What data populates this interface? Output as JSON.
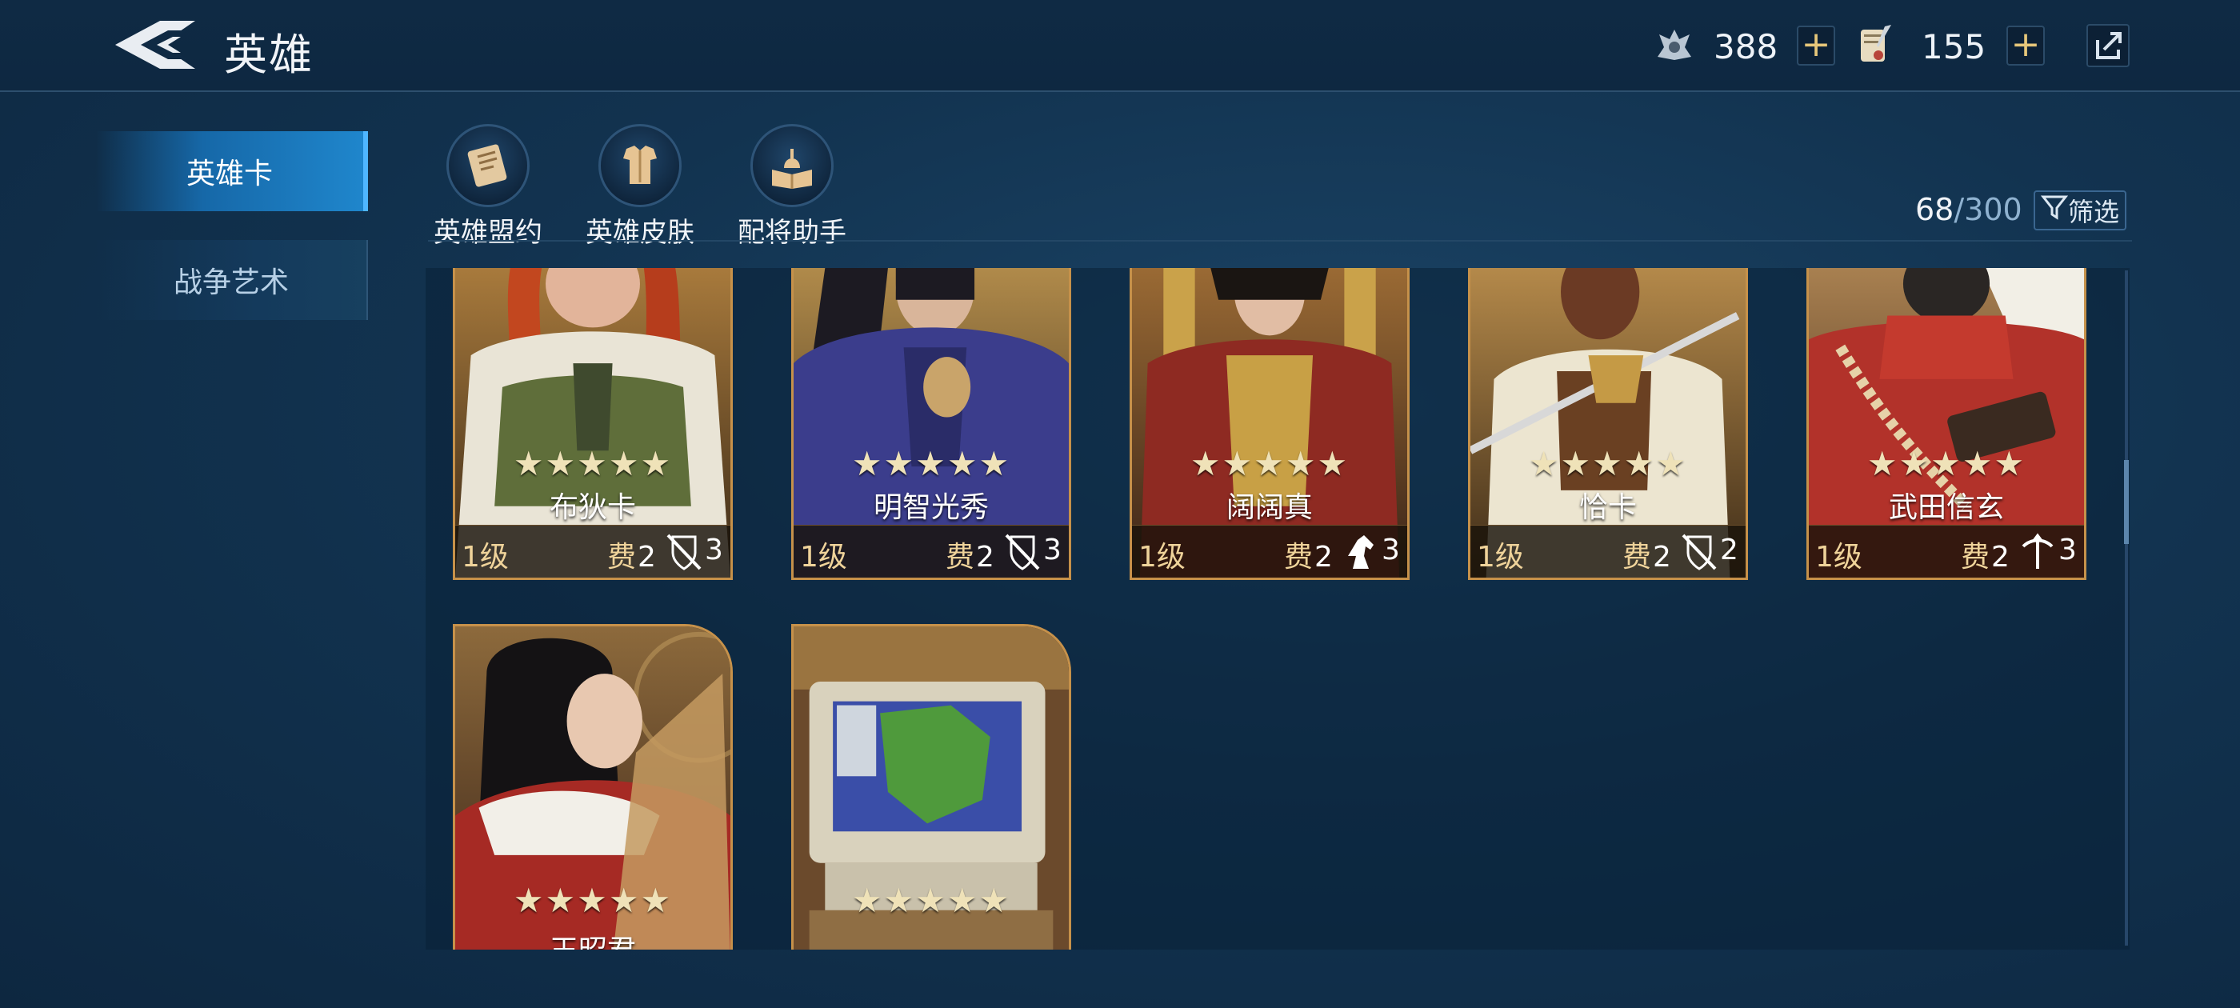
{
  "header": {
    "title": "英雄",
    "resource1_value": "388",
    "resource2_value": "155",
    "plus": "+"
  },
  "nav": {
    "items": [
      {
        "label": "英雄卡",
        "active": true
      },
      {
        "label": "战争艺术",
        "active": false
      }
    ]
  },
  "features": [
    {
      "label": "英雄盟约",
      "icon": "scroll-icon"
    },
    {
      "label": "英雄皮肤",
      "icon": "armor-icon"
    },
    {
      "label": "配将助手",
      "icon": "book-helmet-icon"
    }
  ],
  "collection": {
    "count": "68",
    "separator": "/",
    "total": "300",
    "filter_label": "筛选"
  },
  "cards": [
    {
      "name": "布狄卡",
      "stars": "★★★★★",
      "level": "1级",
      "cost_label": "费",
      "cost": "2",
      "troop_icon": "shield-sword-icon",
      "troop_value": "3"
    },
    {
      "name": "明智光秀",
      "stars": "★★★★★",
      "level": "1级",
      "cost_label": "费",
      "cost": "2",
      "troop_icon": "shield-sword-icon",
      "troop_value": "3"
    },
    {
      "name": "阔阔真",
      "stars": "★★★★★",
      "level": "1级",
      "cost_label": "费",
      "cost": "2",
      "troop_icon": "horse-icon",
      "troop_value": "3"
    },
    {
      "name": "恰卡",
      "stars": "★★★★★",
      "level": "1级",
      "cost_label": "费",
      "cost": "2",
      "troop_icon": "shield-sword-icon",
      "troop_value": "2"
    },
    {
      "name": "武田信玄",
      "stars": "★★★★★",
      "level": "1级",
      "cost_label": "费",
      "cost": "2",
      "troop_icon": "crossbow-icon",
      "troop_value": "3"
    },
    {
      "name": "王昭君",
      "stars": "★★★★★"
    },
    {
      "name": "",
      "stars": "★★★★★"
    }
  ],
  "colors": {
    "accent_gold": "#c6914a",
    "nav_active": "#1f86cc",
    "background": "#123350"
  }
}
